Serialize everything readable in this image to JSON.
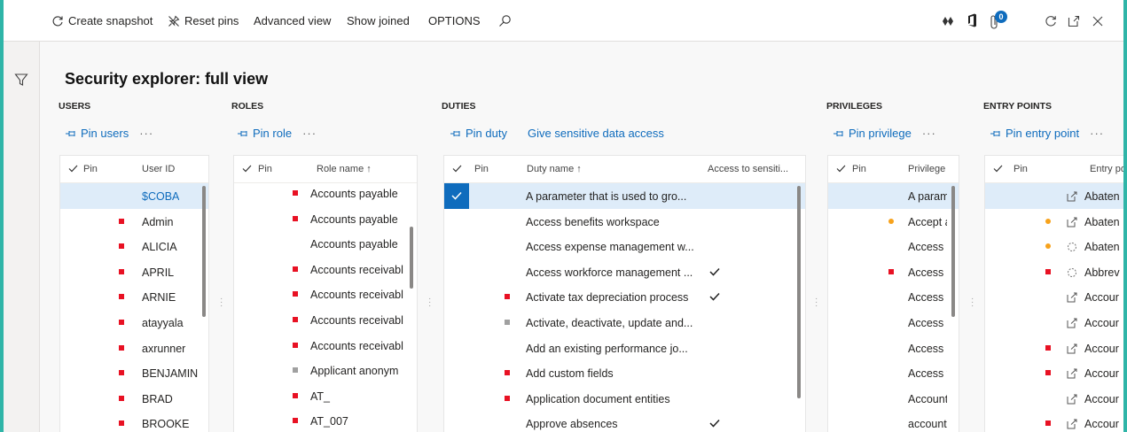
{
  "toolbar": {
    "create_snapshot": "Create snapshot",
    "reset_pins": "Reset pins",
    "advanced_view": "Advanced view",
    "show_joined": "Show joined",
    "options": "OPTIONS",
    "notification_count": "0"
  },
  "page": {
    "title": "Security explorer: full view"
  },
  "users": {
    "section": "USERS",
    "action": "Pin users",
    "col_pin": "Pin",
    "col_id": "User ID",
    "rows": [
      {
        "id": "$COBA",
        "pin": "none",
        "selected": true
      },
      {
        "id": "Admin",
        "pin": "red"
      },
      {
        "id": "ALICIA",
        "pin": "red"
      },
      {
        "id": "APRIL",
        "pin": "red"
      },
      {
        "id": "ARNIE",
        "pin": "red"
      },
      {
        "id": "atayyala",
        "pin": "red"
      },
      {
        "id": "axrunner",
        "pin": "red"
      },
      {
        "id": "BENJAMIN",
        "pin": "red"
      },
      {
        "id": "BRAD",
        "pin": "red"
      },
      {
        "id": "BROOKE",
        "pin": "red"
      }
    ]
  },
  "roles": {
    "section": "ROLES",
    "action": "Pin role",
    "col_pin": "Pin",
    "col_name": "Role name ↑",
    "rows": [
      {
        "name": "Accounts payable ",
        "pin": "red"
      },
      {
        "name": "Accounts payable ",
        "pin": "red"
      },
      {
        "name": "Accounts payable ",
        "pin": "none"
      },
      {
        "name": "Accounts receivabl",
        "pin": "red"
      },
      {
        "name": "Accounts receivabl",
        "pin": "red"
      },
      {
        "name": "Accounts receivabl",
        "pin": "red"
      },
      {
        "name": "Accounts receivabl",
        "pin": "red"
      },
      {
        "name": "Applicant anonym",
        "pin": "gray"
      },
      {
        "name": "AT_",
        "pin": "red"
      },
      {
        "name": "AT_007",
        "pin": "red"
      }
    ]
  },
  "duties": {
    "section": "DUTIES",
    "action_pin": "Pin duty",
    "action_sensitive": "Give sensitive data access",
    "col_pin": "Pin",
    "col_name": "Duty name ↑",
    "col_access": "Access to sensiti...",
    "rows": [
      {
        "name": "A parameter that is used to gro...",
        "pin": "check",
        "access": false,
        "selected": true
      },
      {
        "name": "Access benefits workspace",
        "pin": "none",
        "access": false
      },
      {
        "name": "Access expense management w...",
        "pin": "none",
        "access": false
      },
      {
        "name": "Access workforce management ...",
        "pin": "none",
        "access": true
      },
      {
        "name": "Activate tax depreciation process",
        "pin": "red",
        "access": true
      },
      {
        "name": "Activate, deactivate, update and...",
        "pin": "gray",
        "access": false
      },
      {
        "name": "Add an existing performance jo...",
        "pin": "none",
        "access": false
      },
      {
        "name": "Add custom fields",
        "pin": "red",
        "access": false
      },
      {
        "name": "Application document entities",
        "pin": "red",
        "access": false
      },
      {
        "name": "Approve absences",
        "pin": "none",
        "access": true
      }
    ]
  },
  "privileges": {
    "section": "PRIVILEGES",
    "action": "Pin privilege",
    "col_pin": "Pin",
    "col_name": "Privilege",
    "rows": [
      {
        "name": "A param",
        "pin": "none",
        "selected": true
      },
      {
        "name": "Accept a",
        "pin": "orange"
      },
      {
        "name": "Access b",
        "pin": "none"
      },
      {
        "name": "Access c",
        "pin": "red"
      },
      {
        "name": "Access e",
        "pin": "none"
      },
      {
        "name": "Access e",
        "pin": "none"
      },
      {
        "name": "Access r",
        "pin": "none"
      },
      {
        "name": "Access v",
        "pin": "none"
      },
      {
        "name": "Account",
        "pin": "none"
      },
      {
        "name": "account",
        "pin": "none"
      }
    ]
  },
  "entry_points": {
    "section": "ENTRY POINTS",
    "action": "Pin entry point",
    "col_pin": "Pin",
    "col_name": "Entry po",
    "rows": [
      {
        "name": "Abaten",
        "pin": "none",
        "type": "menu-item-icon",
        "selected": true
      },
      {
        "name": "Abaten",
        "pin": "orange",
        "type": "menu-item-icon"
      },
      {
        "name": "Abaten",
        "pin": "orange",
        "type": "loading-icon"
      },
      {
        "name": "Abbrev",
        "pin": "red",
        "type": "loading-icon"
      },
      {
        "name": "Accour",
        "pin": "none",
        "type": "menu-item-icon"
      },
      {
        "name": "Accour",
        "pin": "none",
        "type": "menu-item-icon"
      },
      {
        "name": "Accour",
        "pin": "red",
        "type": "menu-item-icon"
      },
      {
        "name": "Accour",
        "pin": "red",
        "type": "menu-item-icon"
      },
      {
        "name": "Accour",
        "pin": "none",
        "type": "menu-item-icon"
      },
      {
        "name": "Accour",
        "pin": "red",
        "type": "menu-item-icon"
      }
    ]
  },
  "colors": {
    "accent": "#0f6cbd",
    "selected_row": "#deecf9",
    "pin_red": "#e81123",
    "pin_orange": "#f7a21b",
    "pin_gray": "#a0a0a0",
    "frame": "#2fb5a8"
  }
}
